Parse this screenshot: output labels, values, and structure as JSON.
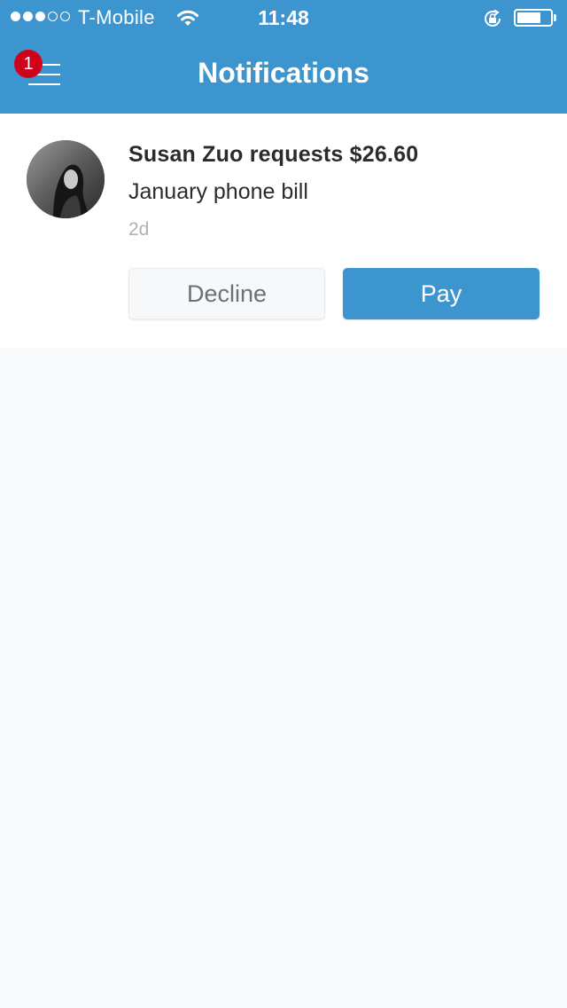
{
  "status_bar": {
    "carrier": "T-Mobile",
    "time": "11:48",
    "signal_bars_filled": 3,
    "signal_bars_total": 5,
    "battery_level": 0.72
  },
  "nav": {
    "title": "Notifications",
    "menu_badge": "1"
  },
  "notification": {
    "title": "Susan Zuo requests $26.60",
    "note": "January phone bill",
    "age": "2d",
    "decline_label": "Decline",
    "pay_label": "Pay"
  },
  "colors": {
    "brand_blue": "#3d95d0",
    "badge_red": "#d0021b",
    "background": "#f8f9fb",
    "decline_text": "#66737d",
    "muted_text": "#b2b2b2"
  },
  "icons": {
    "menu": "hamburger-menu-icon",
    "wifi": "wifi-icon",
    "rotation_lock": "rotation-lock-icon",
    "battery": "battery-icon"
  }
}
